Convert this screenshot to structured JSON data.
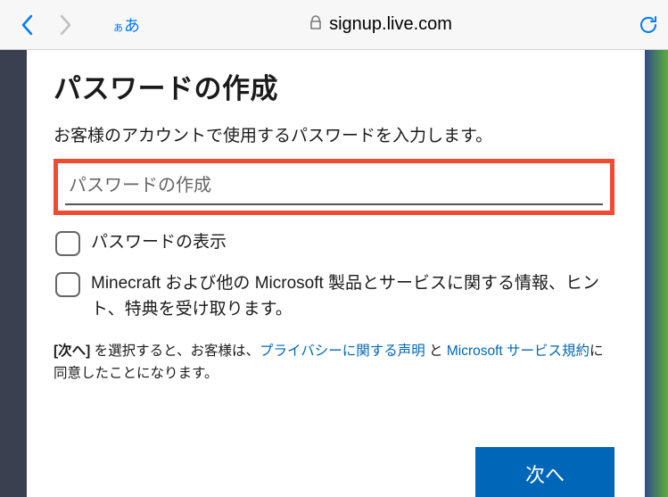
{
  "browser": {
    "aa_small": "ぁ",
    "aa_large": "あ",
    "url": "signup.live.com"
  },
  "page": {
    "title": "パスワードの作成",
    "subtitle": "お客様のアカウントで使用するパスワードを入力します。",
    "password_placeholder": "パスワードの作成",
    "show_password_label": "パスワードの表示",
    "promo_label": "Minecraft および他の Microsoft 製品とサービスに関する情報、ヒント、特典を受け取ります。",
    "legal_prefix": "[次へ]",
    "legal_mid1": " を選択すると、お客様は、",
    "legal_link1": "プライバシーに関する声明",
    "legal_mid2": " と ",
    "legal_link2": "Microsoft サービス規約",
    "legal_suffix": "に同意したことになります。",
    "next_button": "次へ"
  }
}
